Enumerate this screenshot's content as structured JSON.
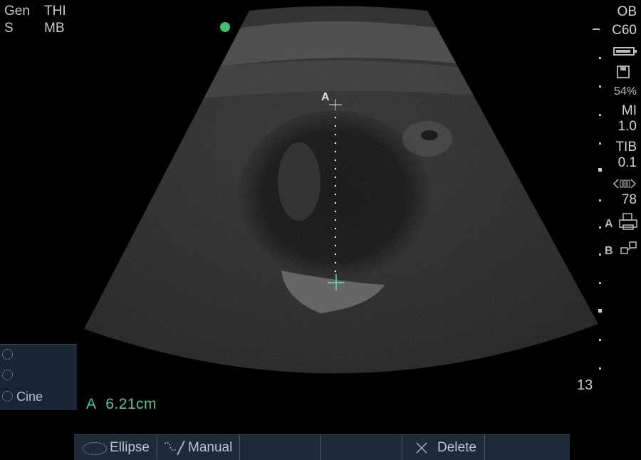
{
  "top_left": {
    "line1_a": "Gen",
    "line1_b": "THI",
    "line2_a": "S",
    "line2_b": "MB"
  },
  "right_panel": {
    "preset": "OB",
    "probe": "C60",
    "storage_percent": "54%",
    "mi_label": "MI",
    "mi_value": "1.0",
    "tib_label": "TIB",
    "tib_value": "0.1",
    "gain_value": "78",
    "print_a_label": "A",
    "print_b_label": "B",
    "depth_value": "13"
  },
  "caliper": {
    "label": "A"
  },
  "measurement": {
    "label": "A",
    "value": "6.21cm"
  },
  "cine_panel": {
    "item3_label": "Cine"
  },
  "bottom_bar": {
    "ellipse_label": "Ellipse",
    "manual_label": "Manual",
    "delete_label": "Delete"
  },
  "colors": {
    "accent_green": "#54c596",
    "status_dot": "#3fbf6f",
    "panel_bg": "#1e2a38"
  }
}
